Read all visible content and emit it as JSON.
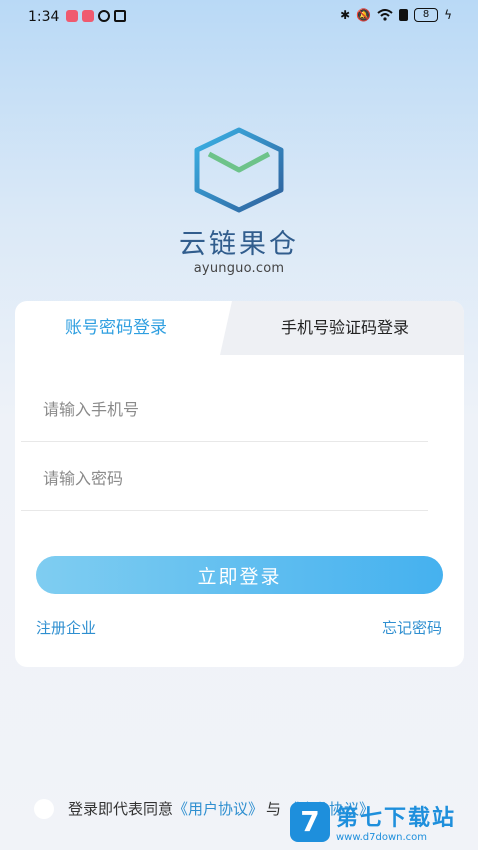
{
  "status_bar": {
    "time": "1:34",
    "battery": "8"
  },
  "brand": {
    "name": "云链果仓",
    "domain": "ayunguo.com"
  },
  "login": {
    "tabs": [
      {
        "label": "账号密码登录",
        "active": true
      },
      {
        "label": "手机号验证码登录",
        "active": false
      }
    ],
    "phone_placeholder": "请输入手机号",
    "password_placeholder": "请输入密码",
    "submit_label": "立即登录",
    "register_label": "注册企业",
    "forgot_label": "忘记密码"
  },
  "agreement": {
    "prefix": "登录即代表同意",
    "user_agreement": "《用户协议》",
    "and": "与",
    "privacy_policy": "《隐私协议》"
  },
  "watermark": {
    "mark": "7",
    "name": "第七下载站",
    "url": "www.d7down.com"
  },
  "colors": {
    "accent": "#2f9fe0",
    "link": "#2f8fd0",
    "button_start": "#7fcdf1",
    "button_end": "#45b1ef",
    "brand_text": "#315d8d"
  }
}
